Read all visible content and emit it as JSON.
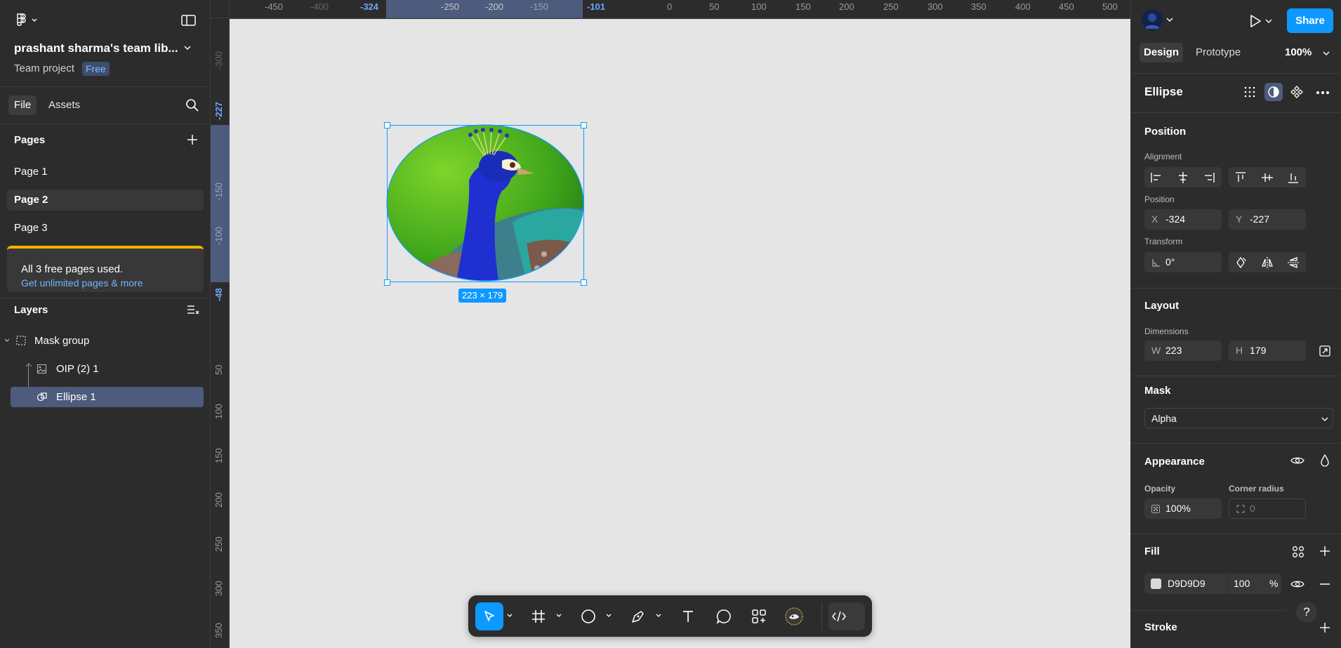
{
  "left_panel": {
    "team_name": "prashant sharma's team lib...",
    "project_type": "Team project",
    "plan_badge": "Free",
    "tabs": [
      {
        "label": "File"
      },
      {
        "label": "Assets"
      }
    ],
    "pages_heading": "Pages",
    "pages": [
      {
        "label": "Page 1"
      },
      {
        "label": "Page 2"
      },
      {
        "label": "Page 3"
      }
    ],
    "upsell": {
      "text": "All 3 free pages used.",
      "link": "Get unlimited pages & more"
    },
    "layers_heading": "Layers",
    "layers": [
      {
        "label": "Mask group"
      },
      {
        "label": "OIP (2) 1"
      },
      {
        "label": "Ellipse 1"
      }
    ]
  },
  "rulers": {
    "top": [
      "-450",
      "-400",
      "-324",
      "-250",
      "-200",
      "-150",
      "-101",
      "0",
      "50",
      "100",
      "150",
      "200",
      "250",
      "300",
      "350",
      "400",
      "450",
      "500"
    ],
    "left": [
      "-300",
      "-227",
      "-150",
      "-100",
      "-48",
      "50",
      "100",
      "150",
      "200",
      "250",
      "300",
      "350"
    ]
  },
  "canvas": {
    "selection_size": "223 × 179"
  },
  "right_panel": {
    "share_label": "Share",
    "tabs": [
      {
        "label": "Design"
      },
      {
        "label": "Prototype"
      }
    ],
    "zoom": "100%",
    "layer_name": "Ellipse",
    "position_heading": "Position",
    "alignment_label": "Alignment",
    "position_label": "Position",
    "x_label": "X",
    "x_value": "-324",
    "y_label": "Y",
    "y_value": "-227",
    "transform_label": "Transform",
    "rotation_value": "0°",
    "layout_heading": "Layout",
    "dimensions_label": "Dimensions",
    "w_label": "W",
    "w_value": "223",
    "h_label": "H",
    "h_value": "179",
    "mask_heading": "Mask",
    "mask_type": "Alpha",
    "appearance_heading": "Appearance",
    "opacity_label": "Opacity",
    "opacity_value": "100%",
    "corner_radius_label": "Corner radius",
    "corner_radius_value": "0",
    "fill_heading": "Fill",
    "fill_hex": "D9D9D9",
    "fill_opacity": "100",
    "fill_percent": "%",
    "stroke_heading": "Stroke",
    "help": "?"
  },
  "colors": {
    "accent": "#0d99ff",
    "panel": "#2c2c2c",
    "canvas": "#e5e5e5",
    "selection": "#4d5b7c",
    "upsell_bar": "#f5b400",
    "link": "#6fb4ff",
    "fill_swatch": "#d9d9d9"
  }
}
